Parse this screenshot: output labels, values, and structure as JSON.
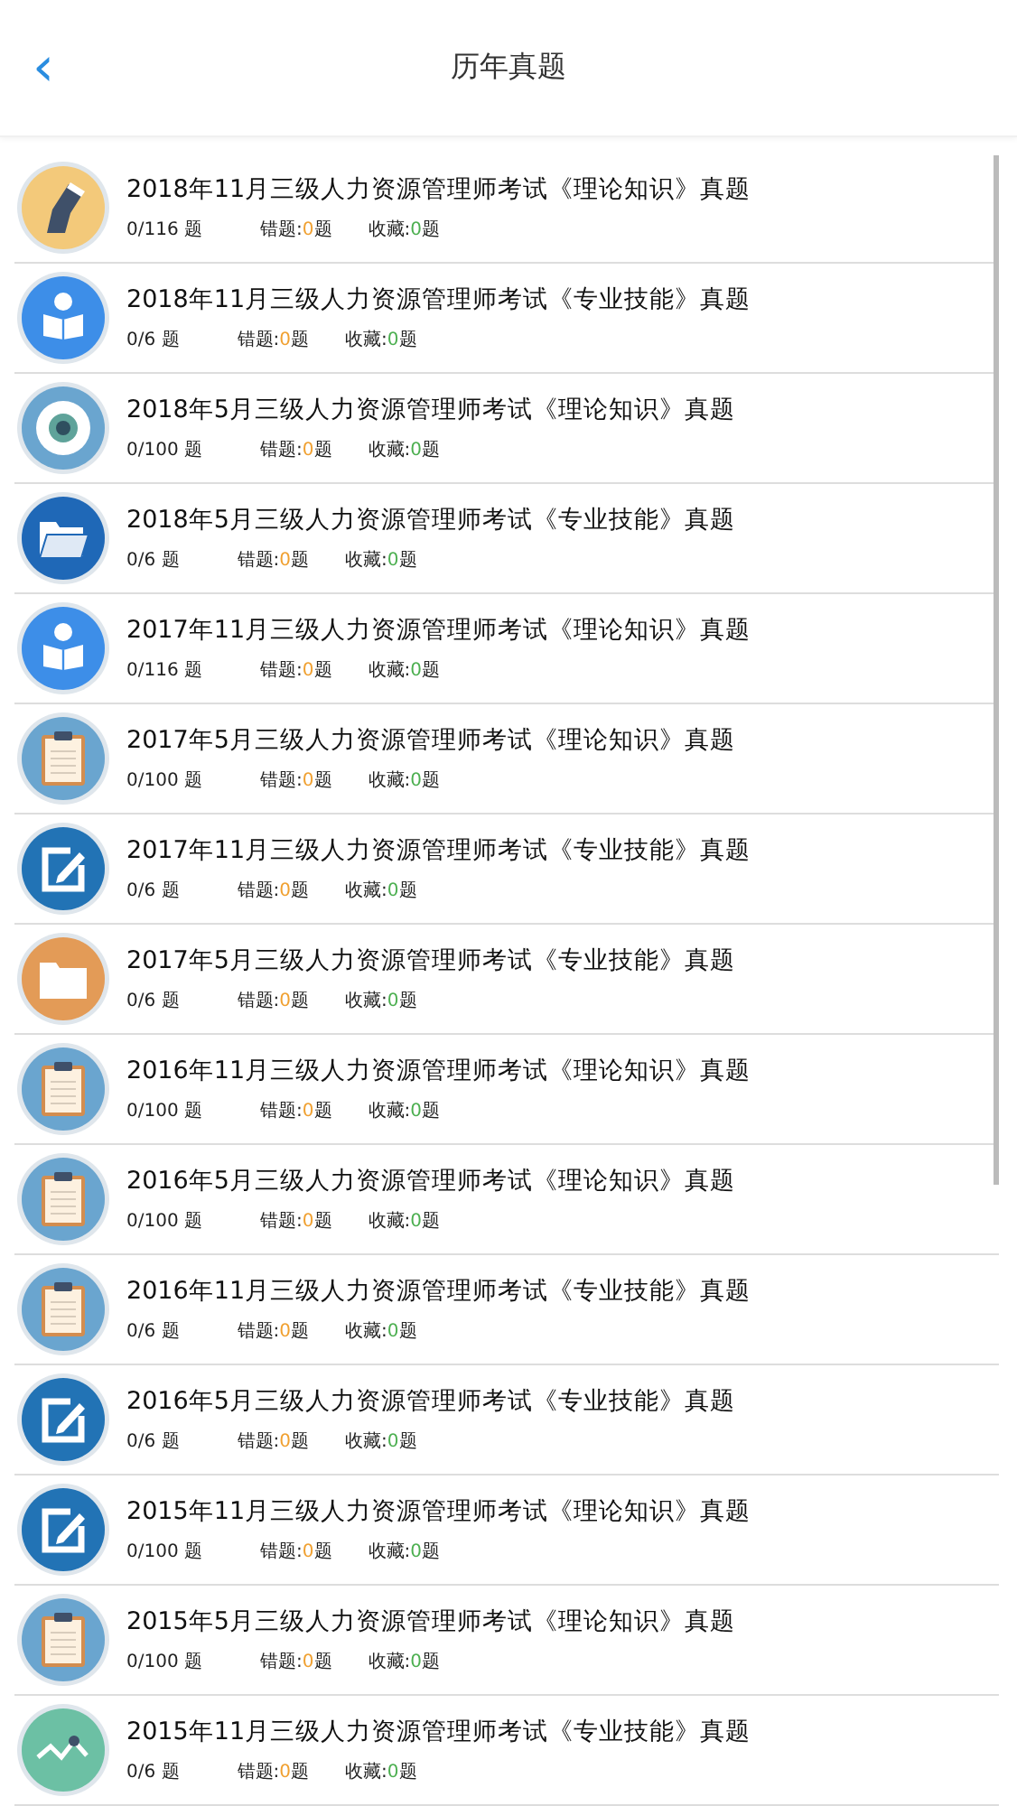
{
  "header": {
    "back": "‹",
    "title": "历年真题"
  },
  "exams": [
    {
      "title": "2018年11月三级人力资源管理师考试《理论知识》真题",
      "progress": "0/116 题",
      "wrong": {
        "label": "错题:",
        "count": "0",
        "unit": "题"
      },
      "saved": {
        "label": "收藏:",
        "count": "0",
        "unit": "题"
      },
      "kind": "knee"
    },
    {
      "title": "2018年11月三级人力资源管理师考试《专业技能》真题",
      "progress": "0/6 题",
      "wrong": {
        "label": "错题:",
        "count": "0",
        "unit": "题"
      },
      "saved": {
        "label": "收藏:",
        "count": "0",
        "unit": "题"
      },
      "kind": "reader"
    },
    {
      "title": "2018年5月三级人力资源管理师考试《理论知识》真题",
      "progress": "0/100 题",
      "wrong": {
        "label": "错题:",
        "count": "0",
        "unit": "题"
      },
      "saved": {
        "label": "收藏:",
        "count": "0",
        "unit": "题"
      },
      "kind": "eye"
    },
    {
      "title": "2018年5月三级人力资源管理师考试《专业技能》真题",
      "progress": "0/6 题",
      "wrong": {
        "label": "错题:",
        "count": "0",
        "unit": "题"
      },
      "saved": {
        "label": "收藏:",
        "count": "0",
        "unit": "题"
      },
      "kind": "folder-open"
    },
    {
      "title": "2017年11月三级人力资源管理师考试《理论知识》真题",
      "progress": "0/116 题",
      "wrong": {
        "label": "错题:",
        "count": "0",
        "unit": "题"
      },
      "saved": {
        "label": "收藏:",
        "count": "0",
        "unit": "题"
      },
      "kind": "reader"
    },
    {
      "title": "2017年5月三级人力资源管理师考试《理论知识》真题",
      "progress": "0/100 题",
      "wrong": {
        "label": "错题:",
        "count": "0",
        "unit": "题"
      },
      "saved": {
        "label": "收藏:",
        "count": "0",
        "unit": "题"
      },
      "kind": "clipboard"
    },
    {
      "title": "2017年11月三级人力资源管理师考试《专业技能》真题",
      "progress": "0/6 题",
      "wrong": {
        "label": "错题:",
        "count": "0",
        "unit": "题"
      },
      "saved": {
        "label": "收藏:",
        "count": "0",
        "unit": "题"
      },
      "kind": "edit"
    },
    {
      "title": "2017年5月三级人力资源管理师考试《专业技能》真题",
      "progress": "0/6 题",
      "wrong": {
        "label": "错题:",
        "count": "0",
        "unit": "题"
      },
      "saved": {
        "label": "收藏:",
        "count": "0",
        "unit": "题"
      },
      "kind": "folder"
    },
    {
      "title": "2016年11月三级人力资源管理师考试《理论知识》真题",
      "progress": "0/100 题",
      "wrong": {
        "label": "错题:",
        "count": "0",
        "unit": "题"
      },
      "saved": {
        "label": "收藏:",
        "count": "0",
        "unit": "题"
      },
      "kind": "clipboard"
    },
    {
      "title": "2016年5月三级人力资源管理师考试《理论知识》真题",
      "progress": "0/100 题",
      "wrong": {
        "label": "错题:",
        "count": "0",
        "unit": "题"
      },
      "saved": {
        "label": "收藏:",
        "count": "0",
        "unit": "题"
      },
      "kind": "clipboard"
    },
    {
      "title": "2016年11月三级人力资源管理师考试《专业技能》真题",
      "progress": "0/6 题",
      "wrong": {
        "label": "错题:",
        "count": "0",
        "unit": "题"
      },
      "saved": {
        "label": "收藏:",
        "count": "0",
        "unit": "题"
      },
      "kind": "clipboard"
    },
    {
      "title": "2016年5月三级人力资源管理师考试《专业技能》真题",
      "progress": "0/6 题",
      "wrong": {
        "label": "错题:",
        "count": "0",
        "unit": "题"
      },
      "saved": {
        "label": "收藏:",
        "count": "0",
        "unit": "题"
      },
      "kind": "edit"
    },
    {
      "title": "2015年11月三级人力资源管理师考试《理论知识》真题",
      "progress": "0/100 题",
      "wrong": {
        "label": "错题:",
        "count": "0",
        "unit": "题"
      },
      "saved": {
        "label": "收藏:",
        "count": "0",
        "unit": "题"
      },
      "kind": "sign"
    },
    {
      "title": "2015年5月三级人力资源管理师考试《理论知识》真题",
      "progress": "0/100 题",
      "wrong": {
        "label": "错题:",
        "count": "0",
        "unit": "题"
      },
      "saved": {
        "label": "收藏:",
        "count": "0",
        "unit": "题"
      },
      "kind": "clipboard"
    },
    {
      "title": "2015年11月三级人力资源管理师考试《专业技能》真题",
      "progress": "0/6 题",
      "wrong": {
        "label": "错题:",
        "count": "0",
        "unit": "题"
      },
      "saved": {
        "label": "收藏:",
        "count": "0",
        "unit": "题"
      },
      "kind": "chart"
    }
  ]
}
